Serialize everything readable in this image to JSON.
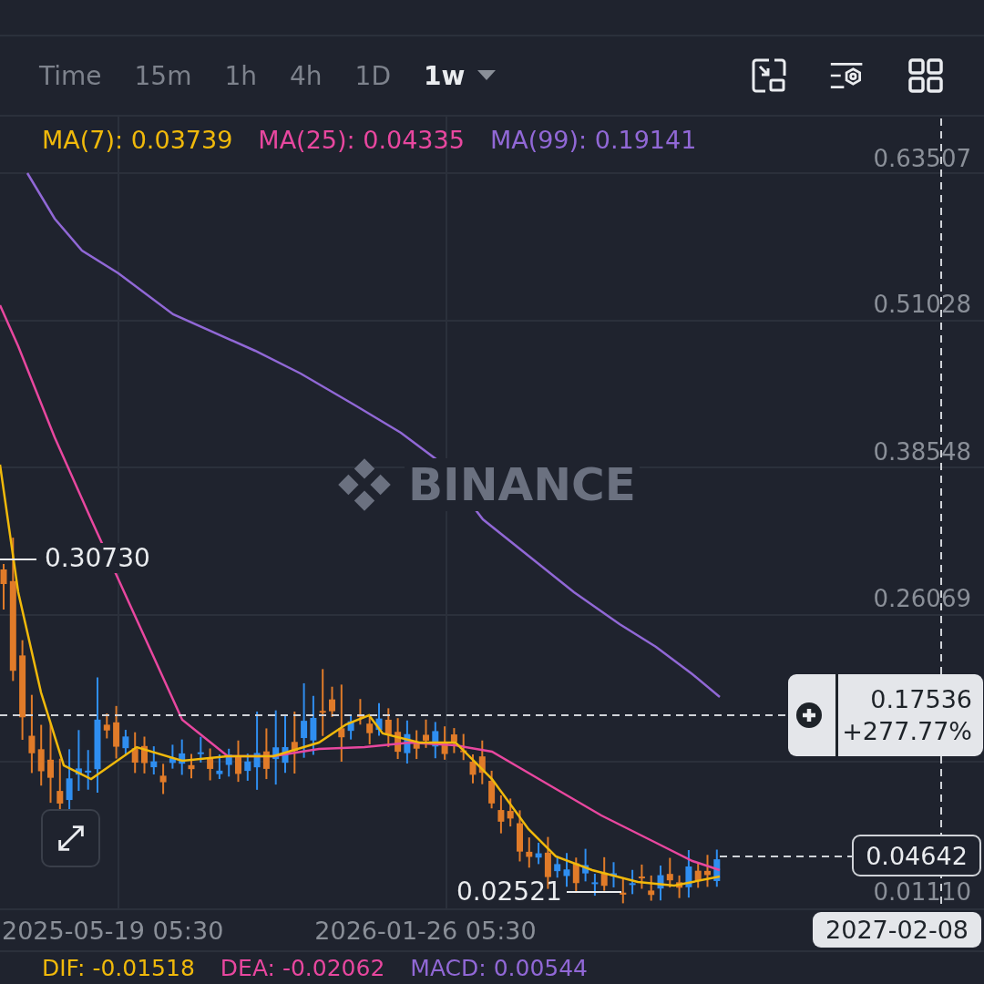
{
  "toolbar": {
    "intervals": [
      {
        "label": "Time",
        "selected": false
      },
      {
        "label": "15m",
        "selected": false
      },
      {
        "label": "1h",
        "selected": false
      },
      {
        "label": "4h",
        "selected": false
      },
      {
        "label": "1D",
        "selected": false
      },
      {
        "label": "1w",
        "selected": true
      }
    ]
  },
  "indicators": [
    {
      "label": "MA(7): 0.03739",
      "color": "#f0b90b"
    },
    {
      "label": "MA(25): 0.04335",
      "color": "#e8479f"
    },
    {
      "label": "MA(99): 0.19141",
      "color": "#9168d6"
    }
  ],
  "chart_logo": "BINANCE",
  "price_axis": [
    "0.63507",
    "0.51028",
    "0.38548",
    "0.26069",
    "0.01110"
  ],
  "markers": {
    "high": "0.30730",
    "low": "0.02521"
  },
  "crosshair": {
    "price": "0.17536",
    "change": "+277.77%",
    "date": "2027-02-08"
  },
  "last_price": "0.04642",
  "time_axis": [
    "2025-05-19 05:30",
    "2026-01-26 05:30"
  ],
  "macd": [
    {
      "label": "DIF: -0.01518",
      "color": "#f0b90b"
    },
    {
      "label": "DEA: -0.02062",
      "color": "#e8479f"
    },
    {
      "label": "MACD: 0.00544",
      "color": "#9168d6"
    }
  ]
}
